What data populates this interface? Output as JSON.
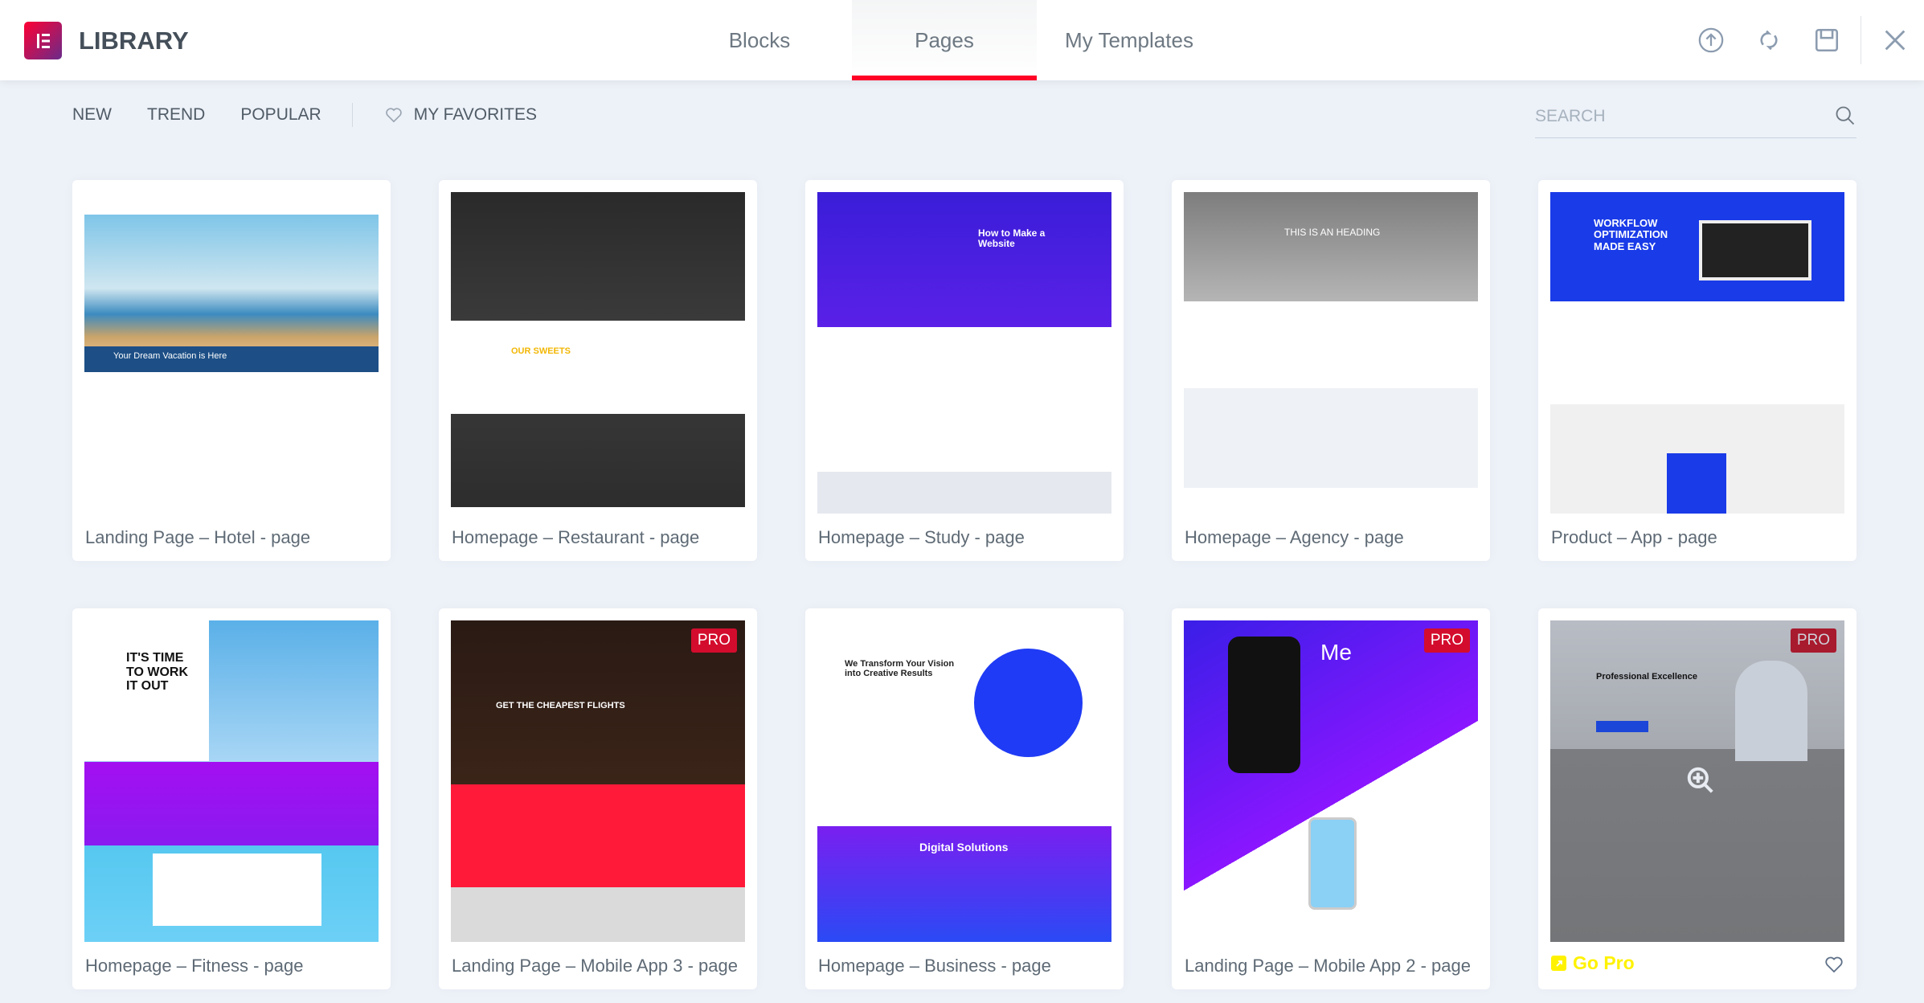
{
  "header": {
    "title": "LIBRARY",
    "tabs": [
      {
        "label": "Blocks",
        "active": false
      },
      {
        "label": "Pages",
        "active": true
      },
      {
        "label": "My Templates",
        "active": false
      }
    ],
    "icons": [
      "upload-icon",
      "sync-icon",
      "save-icon",
      "close-icon"
    ],
    "accent": "#ff0026"
  },
  "filters": {
    "items": [
      "NEW",
      "TREND",
      "POPULAR"
    ],
    "favorites": "MY FAVORITES"
  },
  "search": {
    "placeholder": "SEARCH",
    "value": ""
  },
  "cards": [
    {
      "title": "Landing Page – Hotel - page",
      "pro": false,
      "thumb_text": "Your Dream Vacation is Here"
    },
    {
      "title": "Homepage – Restaurant - page",
      "pro": false,
      "thumb_text": "OUR SWEETS"
    },
    {
      "title": "Homepage – Study - page",
      "pro": false,
      "thumb_text": "How to Make a Website"
    },
    {
      "title": "Homepage – Agency - page",
      "pro": false,
      "thumb_text": "THIS IS AN HEADING"
    },
    {
      "title": "Product – App - page",
      "pro": false,
      "thumb_text": "WORKFLOW OPTIMIZATION MADE EASY"
    },
    {
      "title": "Homepage – Fitness - page",
      "pro": false,
      "thumb_text": "IT'S TIME TO WORK IT OUT"
    },
    {
      "title": "Landing Page – Mobile App 3 - page",
      "pro": true,
      "thumb_text": "GET THE CHEAPEST FLIGHTS"
    },
    {
      "title": "Homepage – Business - page",
      "pro": false,
      "thumb_text": "Digital Solutions"
    },
    {
      "title": "Landing Page – Mobile App 2 - page",
      "pro": true,
      "thumb_text": "Me"
    },
    {
      "title": "Go Pro",
      "pro": true,
      "go_pro": true,
      "thumb_text": "Professional Excellence"
    }
  ],
  "pro_label": "PRO",
  "go_pro_color": "#fff200"
}
